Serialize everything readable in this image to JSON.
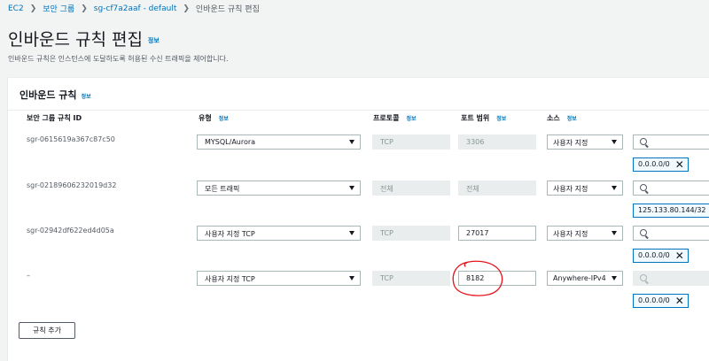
{
  "breadcrumb": {
    "items": [
      "EC2",
      "보안 그룹",
      "sg-cf7a2aaf - default",
      "인바운드 규칙 편집"
    ]
  },
  "page": {
    "title": "인바운드 규칙 편집",
    "info": "정보",
    "description": "인바운드 규칙은 인스턴스에 도달하도록 허용된 수신 트래픽을 제어합니다."
  },
  "panel": {
    "title": "인바운드 규칙",
    "info": "정보"
  },
  "columns": [
    {
      "label": "보안 그룹 규칙 ID",
      "info": ""
    },
    {
      "label": "유형",
      "info": "정보"
    },
    {
      "label": "프로토콜",
      "info": "정보"
    },
    {
      "label": "포트 범위",
      "info": "정보"
    },
    {
      "label": "소스",
      "info": "정보"
    }
  ],
  "rules": [
    {
      "id": "sgr-0615619a367c87c50",
      "type": "MYSQL/Aurora",
      "protocol": "TCP",
      "port": "3306",
      "port_editable": false,
      "source_type": "사용자 지정",
      "cidr": "0.0.0.0/0"
    },
    {
      "id": "sgr-02189606232019d32",
      "type": "모든 트래픽",
      "protocol": "전체",
      "port": "전체",
      "port_editable": false,
      "source_type": "사용자 지정",
      "cidr": "125.133.80.144/32"
    },
    {
      "id": "sgr-02942df622ed4d05a",
      "type": "사용자 지정 TCP",
      "protocol": "TCP",
      "port": "27017",
      "port_editable": true,
      "source_type": "사용자 지정",
      "cidr": "0.0.0.0/0"
    },
    {
      "id": "–",
      "type": "사용자 지정 TCP",
      "protocol": "TCP",
      "port": "8182",
      "port_editable": true,
      "source_type": "Anywhere-IPv4",
      "cidr": "0.0.0.0/0"
    }
  ],
  "actions": {
    "add_rule": "규칙 추가"
  },
  "colors": {
    "link": "#0073bb",
    "annotation": "#e8141c"
  }
}
